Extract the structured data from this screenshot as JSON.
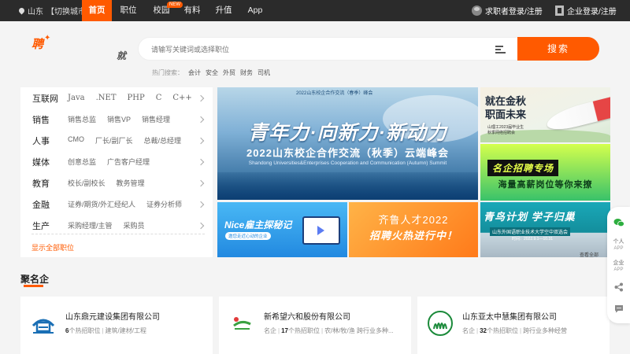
{
  "topbar": {
    "city": "山东",
    "switch_city": "【切换城市】",
    "nav": [
      {
        "label": "首页",
        "active": true
      },
      {
        "label": "职位",
        "active": false
      },
      {
        "label": "校园",
        "active": false,
        "badge": "NEW"
      },
      {
        "label": "有料",
        "active": false
      },
      {
        "label": "升值",
        "active": false
      },
      {
        "label": "App",
        "active": false
      }
    ],
    "job_seeker_login": "求职者登录/注册",
    "company_login": "企业登录/注册"
  },
  "header": {
    "logo_text": "聘",
    "slogan": "就",
    "search_placeholder": "请输写关键词或选择职位",
    "search_button": "搜索",
    "hot_label": "热门搜索：",
    "hot_words": [
      "会计",
      "安全",
      "外贸",
      "财务",
      "司机"
    ]
  },
  "categories": {
    "rows": [
      {
        "name": "互联网",
        "links": [
          "Java",
          ".NET",
          "PHP",
          "C",
          "C++"
        ]
      },
      {
        "name": "销售",
        "links": [
          "销售总监",
          "销售VP",
          "销售经理"
        ]
      },
      {
        "name": "人事",
        "links": [
          "CMO",
          "厂长/副厂长",
          "总裁/总经理"
        ]
      },
      {
        "name": "媒体",
        "links": [
          "创意总监",
          "广告客户经理"
        ]
      },
      {
        "name": "教育",
        "links": [
          "校长/副校长",
          "教务管理"
        ]
      },
      {
        "name": "金融",
        "links": [
          "证券/期货/外汇经纪人",
          "证券分析师"
        ]
      },
      {
        "name": "生产",
        "links": [
          "采购经理/主管",
          "采购员"
        ]
      }
    ],
    "show_all": "显示全部职位"
  },
  "banners": {
    "main": {
      "top_title": "2022山东校企合作交流（春季）峰会",
      "slogan": "青年力·向新力·新动力",
      "subtitle": "2022山东校企合作交流（秋季）云端峰会",
      "english": "Shandong Universities&Enterprises Cooperation and Communication (Autumn) Summit"
    },
    "side1": {
      "title_line1": "就在金秋",
      "title_line2": "职面未来",
      "sub_line1": "山理工2023届毕业生",
      "sub_line2": "秋季网络招聘会"
    },
    "side2": {
      "title": "名企招聘专场",
      "subtitle": "海量高薪岗位等你来撩"
    },
    "nice": {
      "title": "Nice雇主探秘记",
      "subtitle": "邀您走近心动的企业"
    },
    "qilu": {
      "title": "齐鲁人才2022",
      "subtitle": "招聘火热进行中！"
    },
    "qingdao": {
      "title": "青鸟计划 学子归巢",
      "subtitle": "山东外国语职业技术大学空中双选会",
      "date": "时间：2022.9.1—10.31",
      "note": "查看全部"
    }
  },
  "famous": {
    "title": "聚名企",
    "companies": [
      {
        "name": "山东鼎元建设集团有限公司",
        "tag": "",
        "jobs": "6",
        "jobs_suffix": "个热招职位",
        "industry": "建筑/建材/工程",
        "logo": "building-logo",
        "logo_color": "#1a6fb5"
      },
      {
        "name": "新希望六和股份有限公司",
        "tag": "名企",
        "jobs": "17",
        "jobs_suffix": "个热招职位",
        "industry": "农/林/牧/渔 跨行业多种...",
        "logo": "newhope-logo",
        "logo_color": "#3aa142"
      },
      {
        "name": "山东亚太中慧集团有限公司",
        "tag": "名企",
        "jobs": "32",
        "jobs_suffix": "个热招职位",
        "industry": "跨行业多种经营",
        "logo": "yatai-logo",
        "logo_color": "#1b8a3a"
      }
    ]
  },
  "side_tools": [
    {
      "icon": "wechat-icon",
      "label1": "",
      "label2": ""
    },
    {
      "icon": "person-app-icon",
      "label1": "个人",
      "label2": "APP"
    },
    {
      "icon": "company-app-icon",
      "label1": "企业",
      "label2": "APP"
    },
    {
      "icon": "share-icon",
      "label1": "",
      "label2": ""
    },
    {
      "icon": "feedback-icon",
      "label1": "",
      "label2": ""
    }
  ],
  "colors": {
    "accent": "#ff5a00",
    "topbar": "#2b2b2b"
  }
}
